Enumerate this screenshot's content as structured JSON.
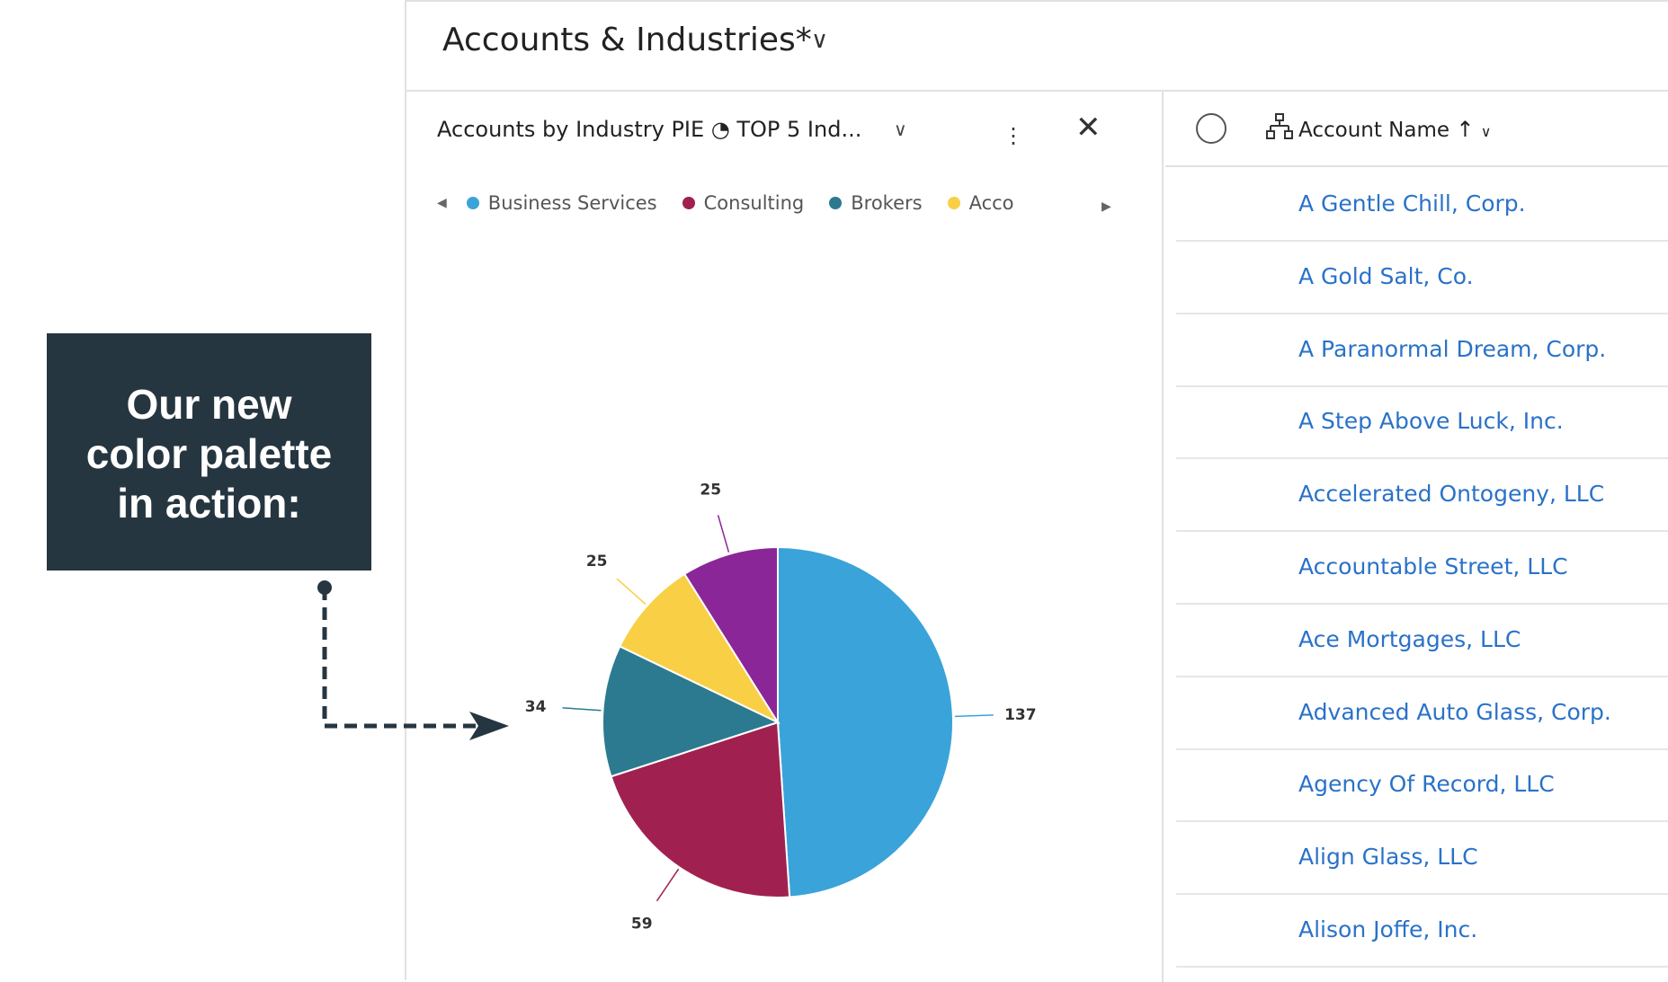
{
  "header": {
    "title": "Accounts & Industries*"
  },
  "chart_panel": {
    "title": "Accounts by Industry PIE ◔ TOP 5 Ind...",
    "more_icon": "more-vertical-icon",
    "close_icon": "close-icon"
  },
  "chart_data": {
    "type": "pie",
    "legend": {
      "placement": "top",
      "visible_entries": [
        "Business Services",
        "Consulting",
        "Brokers",
        "Accountir"
      ]
    },
    "slices": [
      {
        "name": "Business Services",
        "value": 137,
        "color": "#3aa3d9"
      },
      {
        "name": "Consulting",
        "value": 59,
        "color": "#a0214f"
      },
      {
        "name": "Brokers",
        "value": 34,
        "color": "#2c7a8f"
      },
      {
        "name": "Accounting",
        "value": 25,
        "color": "#f8cf45"
      },
      {
        "name": "",
        "value": 25,
        "color": "#8b2698"
      }
    ],
    "data_labels": [
      "137",
      "59",
      "34",
      "25",
      "25"
    ]
  },
  "grid": {
    "column": "Account Name",
    "sort": "ascending",
    "rows": [
      "A Gentle Chill, Corp.",
      "A Gold Salt, Co.",
      "A Paranormal Dream, Corp.",
      "A Step Above Luck, Inc.",
      "Accelerated Ontogeny, LLC",
      "Accountable Street, LLC",
      "Ace Mortgages, LLC",
      "Advanced Auto Glass, Corp.",
      "Agency Of Record, LLC",
      "Align Glass, LLC",
      "Alison Joffe, Inc."
    ]
  },
  "callout": {
    "line1": "Our new",
    "line2": "color palette",
    "line3": "in action:",
    "bg": "#263640"
  }
}
